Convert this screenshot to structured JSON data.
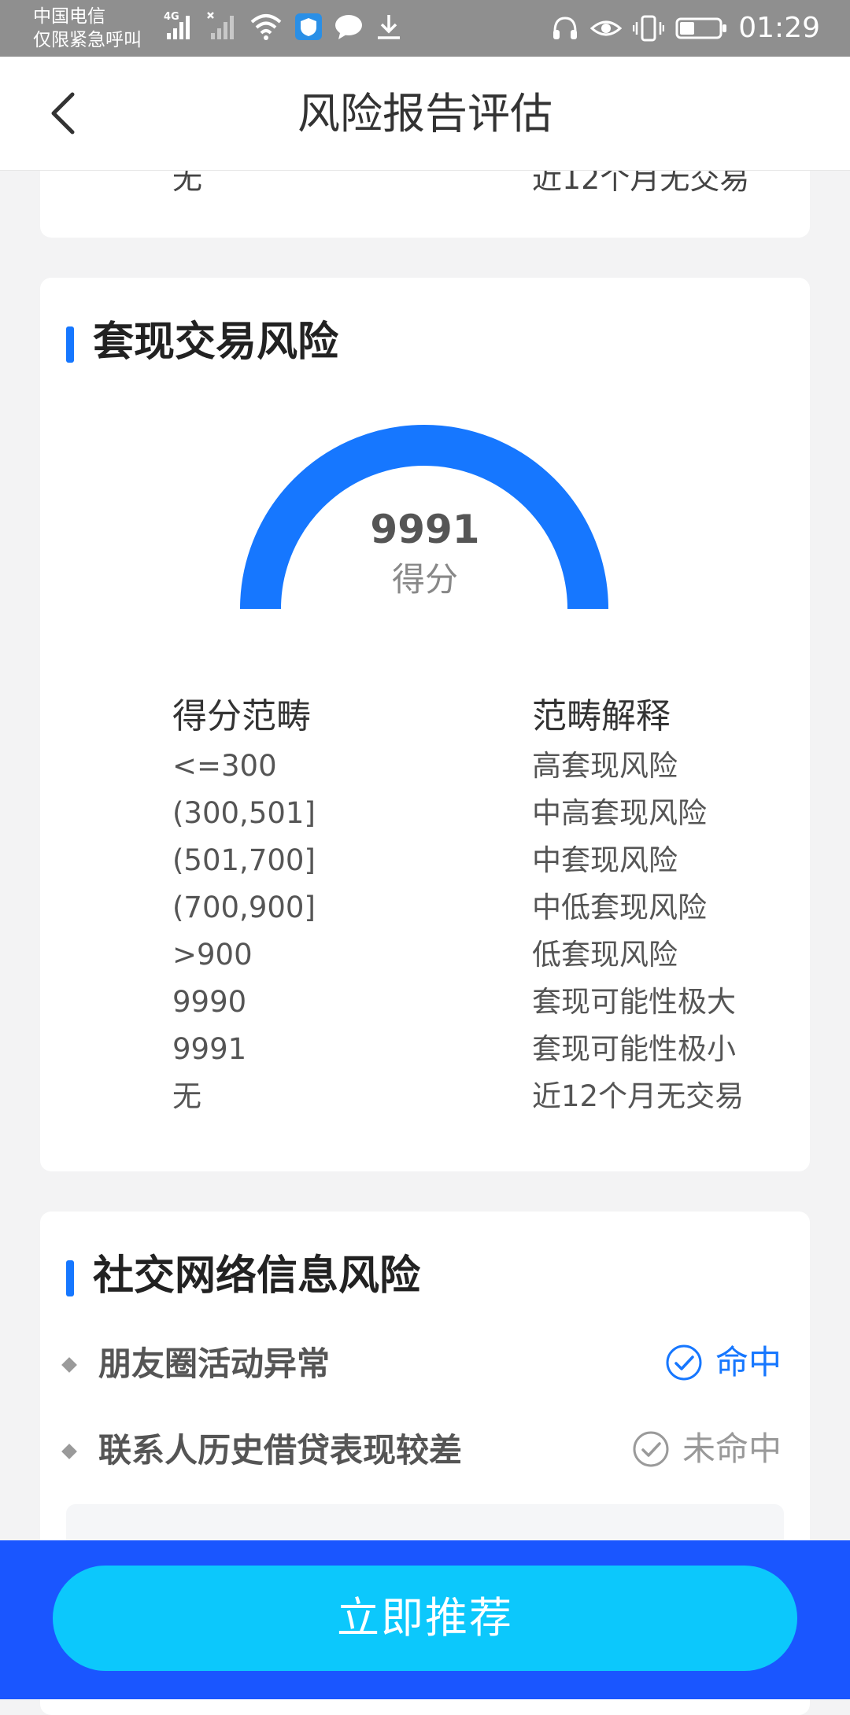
{
  "status_bar": {
    "carrier_line1": "中国电信",
    "carrier_line2": "仅限紧急呼叫",
    "network": "4G",
    "time": "01:29"
  },
  "header": {
    "title": "风险报告评估",
    "back_icon": "chevron-left-icon"
  },
  "previous_card": {
    "left": "无",
    "right": "近12个月无交易"
  },
  "cash_risk": {
    "title": "套现交易风险",
    "gauge": {
      "score": "9991",
      "label": "得分",
      "fill_fraction": 1.0,
      "color": "#1677ff"
    },
    "table": {
      "headers": [
        "得分范畴",
        "范畴解释"
      ],
      "rows": [
        [
          "<=300",
          "高套现风险"
        ],
        [
          "(300,501]",
          "中高套现风险"
        ],
        [
          "(501,700]",
          "中套现风险"
        ],
        [
          "(700,900]",
          "中低套现风险"
        ],
        [
          ">900",
          "低套现风险"
        ],
        [
          "9990",
          "套现可能性极大"
        ],
        [
          "9991",
          "套现可能性极小"
        ],
        [
          "无",
          "近12个月无交易"
        ]
      ]
    }
  },
  "social_risk": {
    "title": "社交网络信息风险",
    "items": [
      {
        "label": "朋友圈活动异常",
        "status": "命中",
        "hit": true
      },
      {
        "label": "联系人历史借贷表现较差",
        "status": "未命中",
        "hit": false
      }
    ]
  },
  "cta": {
    "label": "立即推荐"
  },
  "colors": {
    "accent": "#1677ff",
    "cta": "#0cc8fc",
    "bottom_bar": "#1a56ff"
  }
}
